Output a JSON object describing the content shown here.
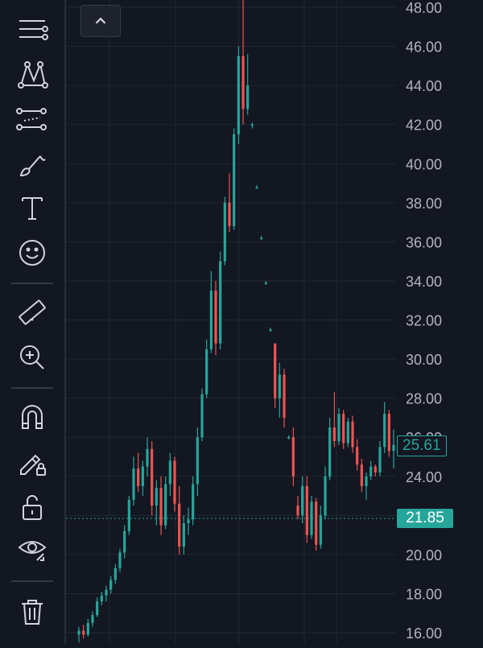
{
  "toolbar": {
    "items": [
      {
        "name": "trend-lines-icon"
      },
      {
        "name": "patterns-icon"
      },
      {
        "name": "forecasting-icon"
      },
      {
        "name": "brush-icon"
      },
      {
        "name": "text-icon"
      },
      {
        "name": "emoji-icon"
      },
      {
        "name": "ruler-icon"
      },
      {
        "name": "zoom-in-icon"
      },
      {
        "name": "magnet-icon"
      },
      {
        "name": "lock-drawing-icon"
      },
      {
        "name": "unlock-icon"
      },
      {
        "name": "eye-icon"
      },
      {
        "name": "trash-icon"
      }
    ]
  },
  "chart_data": {
    "type": "candlestick",
    "y_ticks": [
      "48.00",
      "46.00",
      "44.00",
      "42.00",
      "40.00",
      "38.00",
      "36.00",
      "34.00",
      "32.00",
      "30.00",
      "28.00",
      "26.00",
      "24.00",
      "22.00",
      "20.00",
      "18.00",
      "16.00"
    ],
    "ylim": [
      15.5,
      48.5
    ],
    "up_color": "#26a69a",
    "down_color": "#ef5350",
    "last_price": "25.61",
    "crosshair_price": "21.85",
    "grid": true,
    "candles": [
      [
        15.9,
        16.3,
        15.5,
        16.1
      ],
      [
        16.1,
        16.4,
        15.7,
        15.9
      ],
      [
        15.9,
        16.7,
        15.8,
        16.5
      ],
      [
        16.5,
        17.1,
        16.3,
        16.9
      ],
      [
        16.9,
        17.8,
        16.8,
        17.6
      ],
      [
        17.6,
        18.1,
        17.4,
        17.9
      ],
      [
        17.9,
        18.4,
        17.6,
        18.2
      ],
      [
        18.2,
        18.9,
        18.0,
        18.7
      ],
      [
        18.7,
        19.5,
        18.5,
        19.3
      ],
      [
        19.3,
        20.3,
        19.1,
        20.1
      ],
      [
        20.1,
        21.5,
        19.8,
        21.2
      ],
      [
        21.2,
        23.0,
        21.0,
        22.8
      ],
      [
        22.8,
        25.0,
        22.5,
        24.4
      ],
      [
        24.4,
        25.2,
        23.2,
        23.5
      ],
      [
        23.5,
        24.8,
        23.0,
        24.5
      ],
      [
        24.5,
        26.0,
        24.0,
        25.4
      ],
      [
        25.4,
        25.8,
        22.0,
        22.5
      ],
      [
        22.5,
        23.8,
        21.5,
        23.4
      ],
      [
        23.4,
        24.0,
        21.0,
        21.5
      ],
      [
        21.5,
        24.0,
        21.3,
        23.6
      ],
      [
        23.6,
        25.2,
        23.0,
        24.8
      ],
      [
        24.8,
        25.0,
        22.2,
        22.6
      ],
      [
        22.6,
        23.5,
        20.0,
        20.4
      ],
      [
        20.4,
        22.0,
        20.0,
        21.6
      ],
      [
        21.6,
        22.4,
        21.0,
        21.8
      ],
      [
        21.8,
        24.0,
        21.5,
        23.6
      ],
      [
        23.6,
        26.5,
        23.0,
        26.0
      ],
      [
        26.0,
        28.5,
        25.8,
        28.2
      ],
      [
        28.2,
        31.0,
        28.0,
        30.5
      ],
      [
        30.5,
        34.5,
        30.3,
        33.5
      ],
      [
        33.5,
        34.0,
        30.2,
        30.8
      ],
      [
        30.8,
        35.5,
        30.5,
        35.0
      ],
      [
        35.0,
        38.3,
        34.8,
        38.0
      ],
      [
        38.0,
        39.5,
        36.5,
        36.8
      ],
      [
        36.8,
        41.8,
        36.6,
        41.5
      ],
      [
        41.5,
        46.0,
        41.0,
        45.5
      ],
      [
        45.5,
        48.5,
        42.0,
        42.8
      ],
      [
        42.8,
        45.6,
        42.5,
        44.0
      ],
      [
        42.0,
        42.1,
        41.8,
        42.0
      ],
      [
        38.8,
        38.9,
        38.7,
        38.8
      ],
      [
        36.2,
        36.3,
        36.1,
        36.2
      ],
      [
        33.9,
        34.0,
        33.8,
        33.9
      ],
      [
        31.5,
        31.6,
        31.4,
        31.5
      ],
      [
        30.8,
        30.8,
        27.5,
        28.0
      ],
      [
        28.0,
        29.8,
        27.0,
        29.2
      ],
      [
        29.2,
        29.5,
        26.5,
        27.0
      ],
      [
        26.0,
        26.1,
        25.9,
        26.0
      ],
      [
        26.0,
        26.5,
        23.5,
        24.0
      ],
      [
        22.5,
        23.0,
        21.8,
        22.0
      ],
      [
        22.0,
        24.0,
        21.6,
        23.5
      ],
      [
        23.5,
        24.0,
        20.6,
        21.0
      ],
      [
        21.0,
        23.0,
        20.8,
        22.7
      ],
      [
        22.7,
        22.9,
        20.2,
        20.5
      ],
      [
        20.5,
        22.5,
        20.3,
        22.0
      ],
      [
        22.0,
        24.5,
        21.8,
        24.0
      ],
      [
        24.0,
        27.0,
        23.8,
        26.5
      ],
      [
        26.5,
        28.3,
        25.5,
        25.8
      ],
      [
        25.8,
        27.5,
        25.6,
        27.2
      ],
      [
        27.2,
        27.4,
        25.4,
        25.7
      ],
      [
        25.7,
        27.0,
        25.5,
        26.8
      ],
      [
        26.8,
        27.1,
        25.2,
        25.5
      ],
      [
        25.5,
        25.9,
        24.3,
        24.6
      ],
      [
        24.6,
        24.9,
        23.2,
        23.5
      ],
      [
        23.5,
        24.2,
        22.8,
        24.0
      ],
      [
        24.0,
        24.8,
        23.8,
        24.5
      ],
      [
        24.5,
        24.6,
        24.0,
        24.2
      ],
      [
        24.2,
        25.8,
        24.0,
        25.5
      ],
      [
        25.5,
        27.8,
        25.2,
        27.2
      ],
      [
        27.2,
        27.4,
        25.0,
        25.3
      ],
      [
        25.3,
        26.4,
        24.4,
        25.61
      ]
    ]
  }
}
